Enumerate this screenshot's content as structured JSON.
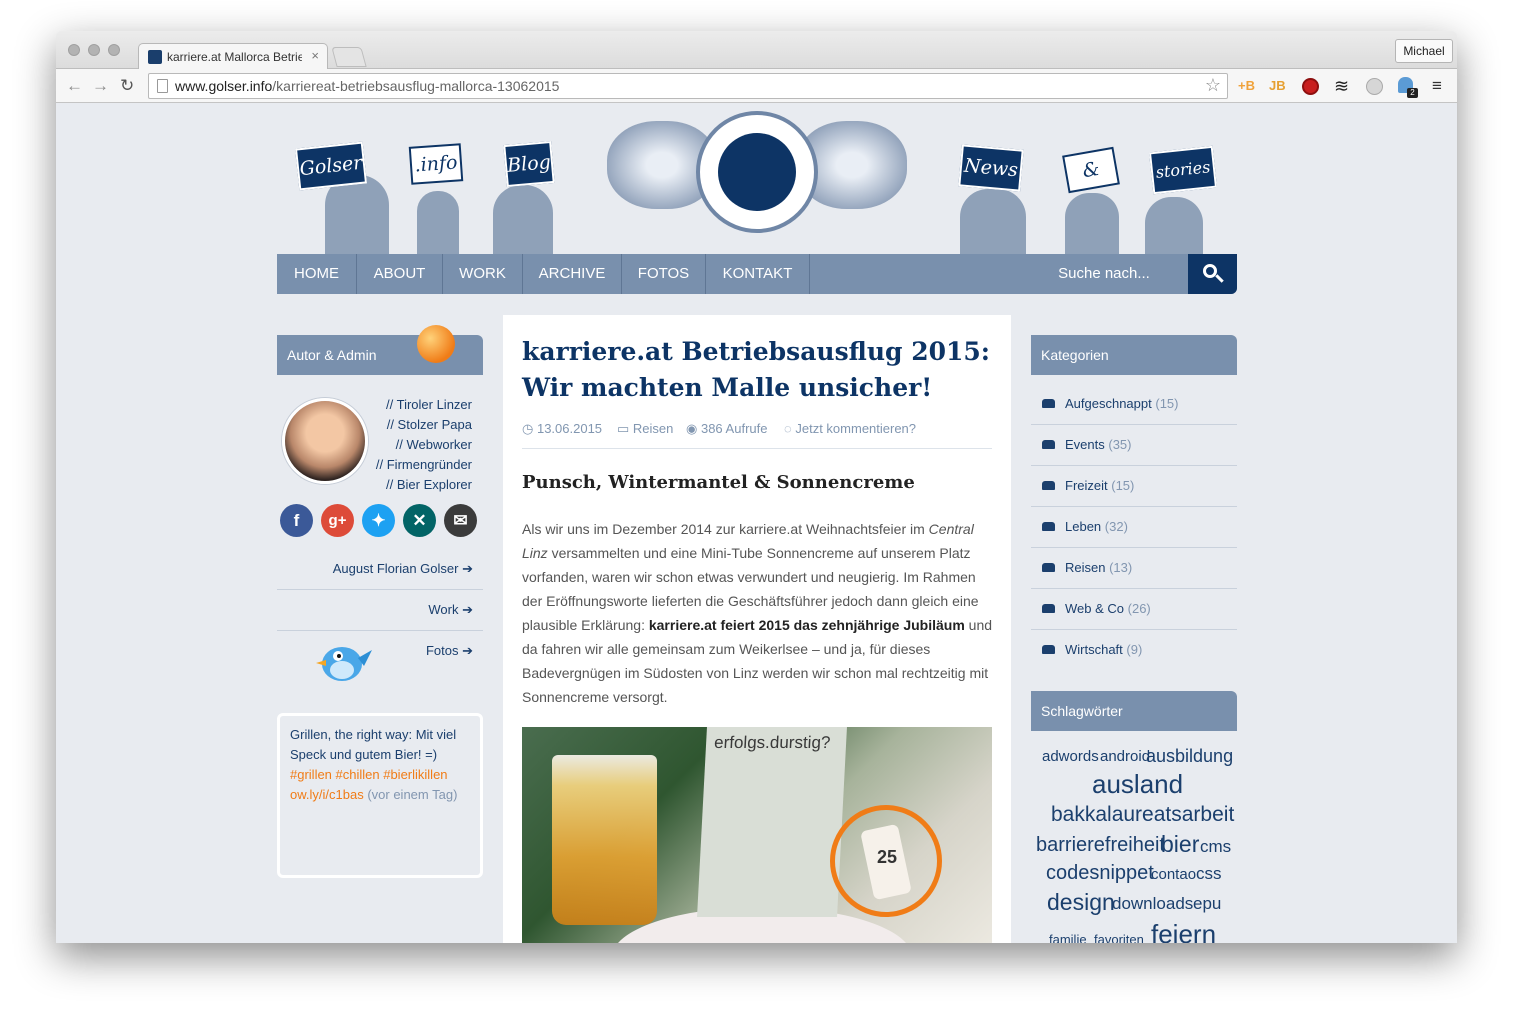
{
  "browser": {
    "tab_title": "karriere.at Mallorca Betrieb",
    "tab_close": "×",
    "profile_name": "Michael",
    "url_host": "www.golser.info",
    "url_path": "/karriereat-betriebsausflug-mallorca-13062015",
    "icons": {
      "back": "back-arrow-icon",
      "forward": "forward-arrow-icon",
      "reload": "reload-icon",
      "star": "bookmark-star-icon",
      "menu": "hamburger-menu-icon"
    },
    "extensions": [
      "+B",
      "JB"
    ],
    "extension_badge": "2"
  },
  "header": {
    "signs": [
      "Golser",
      ".info",
      "Blog",
      "News",
      "&",
      "stories"
    ]
  },
  "nav": {
    "items": [
      "HOME",
      "ABOUT",
      "WORK",
      "ARCHIVE",
      "FOTOS",
      "KONTAKT"
    ],
    "search_placeholder": "Suche nach..."
  },
  "sidebar_left": {
    "title": "Autor & Admin",
    "roles": [
      "// Tiroler Linzer",
      "// Stolzer Papa",
      "// Webworker",
      "// Firmengründer",
      "// Bier Explorer"
    ],
    "social": [
      "f",
      "g+"
    ],
    "links": [
      "August Florian Golser",
      "Work",
      "Fotos"
    ],
    "link_arrow": "➔",
    "tweet": {
      "text": "Grillen, the right way: Mit viel Speck und gutem Bier! =)",
      "hashtags": "#grillen #chillen #bierlikillen",
      "link": "ow.ly/i/c1bas",
      "time": "(vor einem Tag)"
    },
    "colors": {
      "facebook": "#3b5998",
      "google": "#dd4b39",
      "twitter": "#1da1f2",
      "xing": "#026466",
      "mail": "#3b3b3b",
      "accent": "#f07c17"
    }
  },
  "article": {
    "title": "karriere.at Betriebsausflug 2015: Wir machten Malle unsicher!",
    "date": "13.06.2015",
    "category": "Reisen",
    "views": "386 Aufrufe",
    "comments": "Jetzt kommentieren?",
    "subheading": "Punsch, Wintermantel & Sonnencreme",
    "p1_start": "Als wir uns im Dezember 2014 zur karriere.at Weihnachtsfeier im ",
    "p1_italic": "Central Linz",
    "p1_mid": " versammelten und eine Mini-Tube Sonnencreme auf unserem Platz vorfanden, waren wir schon etwas verwundert und neugierig. Im Rahmen der Eröffnungsworte lieferten die Geschäftsführer jedoch dann gleich eine plausible Erklärung: ",
    "p1_bold": "karriere.at feiert 2015 das zehnjährige Jubiläum",
    "p1_end": " und da fahren wir alle gemeinsam zum Weikerlsee – und ja, für dieses Badevergnügen im Südosten von Linz werden wir schon mal rechtzeitig mit Sonnencreme versorgt.",
    "photo_card_title": "erfolgs.durstig?",
    "photo_spf": "25"
  },
  "sidebar_right": {
    "categories_title": "Kategorien",
    "categories": [
      {
        "name": "Aufgeschnappt",
        "count": "(15)"
      },
      {
        "name": "Events",
        "count": "(35)"
      },
      {
        "name": "Freizeit",
        "count": "(15)"
      },
      {
        "name": "Leben",
        "count": "(32)"
      },
      {
        "name": "Reisen",
        "count": "(13)"
      },
      {
        "name": "Web & Co",
        "count": "(26)"
      },
      {
        "name": "Wirtschaft",
        "count": "(9)"
      }
    ],
    "tags_title": "Schlagwörter",
    "tags": [
      "adwords",
      "android",
      "ausbildung",
      "ausland",
      "bakkalaureatsarbeit",
      "barrierefreiheit",
      "bier",
      "cms",
      "codesnippet",
      "contao",
      "css",
      "design",
      "downloads",
      "epu",
      "familie",
      "favoriten",
      "feiern"
    ]
  }
}
